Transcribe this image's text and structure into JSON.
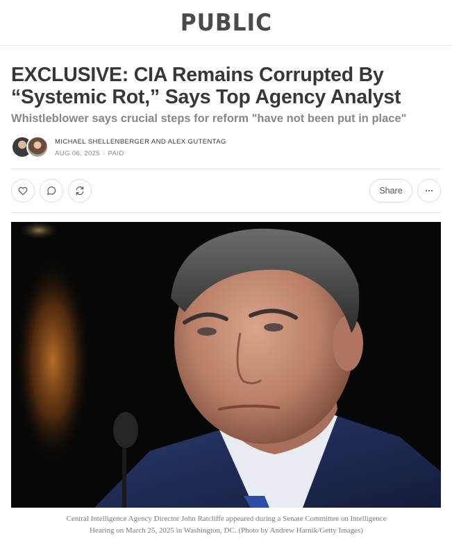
{
  "publication": {
    "name": "PUBLIC"
  },
  "article": {
    "title": "EXCLUSIVE: CIA Remains Corrupted By “Systemic Rot,” Says Top Agency Analyst",
    "subtitle": "Whistleblower says crucial steps for reform \"have not been put in place\"",
    "authors": "MICHAEL SHELLENBERGER AND ALEX GUTENTAG",
    "date": "AUG 06, 2025",
    "access": "PAID"
  },
  "actions": {
    "like_icon": "heart-icon",
    "comment_icon": "comment-icon",
    "restack_icon": "restack-icon",
    "share_label": "Share",
    "more_icon": "ellipsis-icon"
  },
  "hero": {
    "caption": "Central Intelligence Agency Director John Ratcliffe appeared during a Senate Committee on Intelligence Hearing on March 25, 2025 in Washington, DC. (Photo by Andrew Harnik/Getty Images)"
  },
  "colors": {
    "text": "#363737",
    "muted": "#868787",
    "border": "#e6e6e6"
  }
}
